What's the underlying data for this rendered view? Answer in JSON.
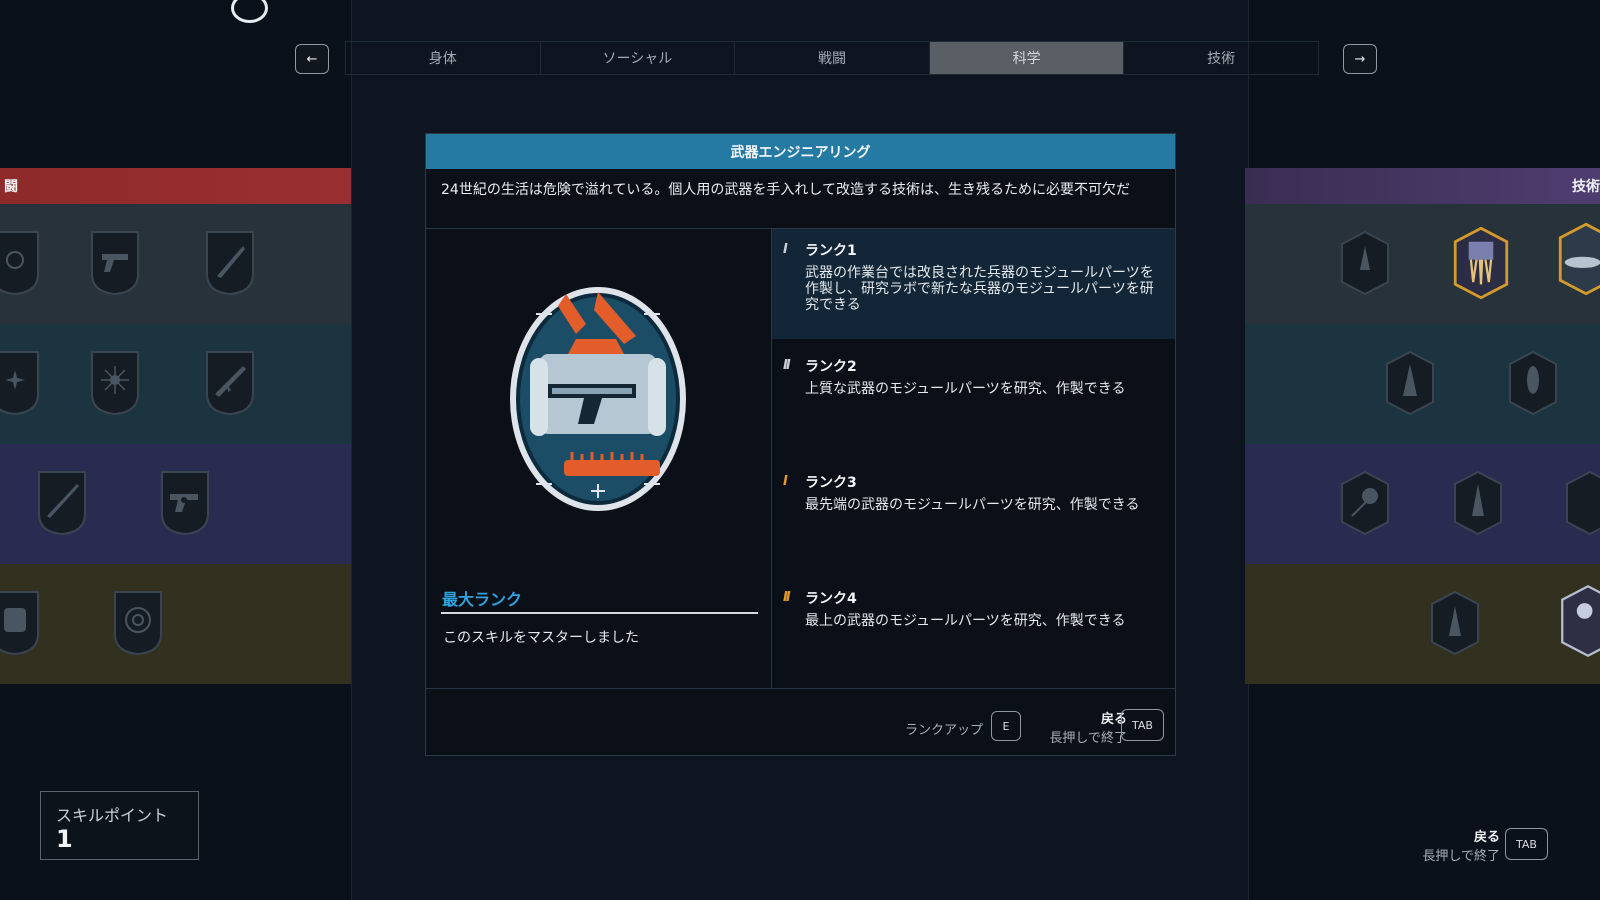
{
  "tabs": {
    "prev_arrow": "←",
    "next_arrow": "→",
    "items": [
      "身体",
      "ソーシャル",
      "戦闘",
      "科学",
      "技術"
    ],
    "active": "科学"
  },
  "side_headers": {
    "left": "闘",
    "right": "技術"
  },
  "modal": {
    "title": "武器エンジニアリング",
    "description": "24世紀の生活は危険で溢れている。個人用の武器を手入れして改造する技術は、生き残るために必要不可欠だ",
    "max_rank_label": "最大ランク",
    "max_rank_text": "このスキルをマスターしました",
    "ranks": [
      {
        "mark": "I",
        "name": "ランク1",
        "desc": "武器の作業台では改良された兵器のモジュールパーツを作製し、研究ラボで新たな兵器のモジュールパーツを研究できる",
        "color": "#c9cfd6"
      },
      {
        "mark": "II",
        "name": "ランク2",
        "desc": "上質な武器のモジュールパーツを研究、作製できる",
        "color": "#c9cfd6"
      },
      {
        "mark": "I",
        "name": "ランク3",
        "desc": "最先端の武器のモジュールパーツを研究、作製できる",
        "color": "#e29a2c"
      },
      {
        "mark": "II",
        "name": "ランク4",
        "desc": "最上の武器のモジュールパーツを研究、作製できる",
        "color": "#e29a2c"
      }
    ],
    "footer": {
      "rank_up_label": "ランクアップ",
      "rank_up_key": "E",
      "back_label": "戻る",
      "hold_label": "長押しで終了",
      "back_key": "TAB"
    }
  },
  "skill_points": {
    "label": "スキルポイント",
    "value": "1"
  },
  "bottom_right": {
    "back_label": "戻る",
    "hold_label": "長押しで終了",
    "key": "TAB"
  },
  "colors": {
    "accent": "#247aa3",
    "max_rank": "#2fa3e0",
    "rank_gold": "#e29a2c",
    "combat_red": "#8e2a2a",
    "tech_purple": "#4f3d70"
  }
}
